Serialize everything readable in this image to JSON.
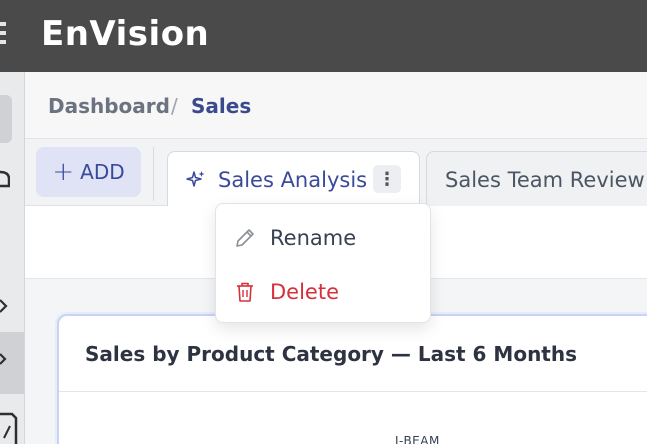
{
  "app": {
    "title": "EnVision"
  },
  "breadcrumb": {
    "items": [
      "Dashboard",
      "Sales"
    ],
    "separator": "/"
  },
  "toolbar": {
    "add_label": "ADD"
  },
  "tabs": [
    {
      "label": "Sales Analysis",
      "active": true
    },
    {
      "label": "Sales Team Review",
      "active": false
    }
  ],
  "tab_menu": {
    "items": [
      {
        "label": "Rename",
        "icon": "pencil-icon"
      },
      {
        "label": "Delete",
        "icon": "trash-icon",
        "color": "#d6303a"
      }
    ]
  },
  "card": {
    "title": "Sales by Product Category — Last 6 Months",
    "partial_label": "I-BEAM"
  },
  "colors": {
    "header": "#4a4a4a",
    "accent": "#3a4a9a",
    "danger": "#d6303a"
  }
}
